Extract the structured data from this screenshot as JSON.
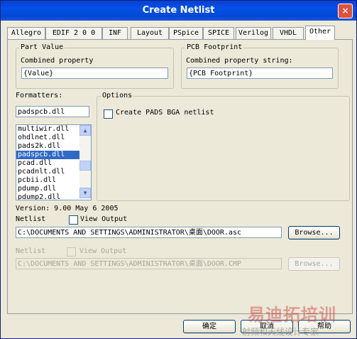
{
  "window": {
    "title": "Create Netlist",
    "close_glyph": "×"
  },
  "tabs": [
    "Allegro",
    "EDIF 2 0 0",
    "INF",
    "Layout",
    "PSpice",
    "SPICE",
    "Verilog",
    "VHDL",
    "Other"
  ],
  "active_tab": "Other",
  "part_value": {
    "group_label": "Part Value",
    "field_label": "Combined property",
    "field_value": "{Value}"
  },
  "pcb_footprint": {
    "group_label": "PCB Footprint",
    "field_label": "Combined property string:",
    "field_value": "{PCB Footprint}"
  },
  "formatters": {
    "label": "Formatters:",
    "value": "padspcb.dll",
    "items": [
      "multiwir.dll",
      "ohdlnet.dll",
      "pads2k.dll",
      "padspcb.dll",
      "pcad.dll",
      "pcadnlt.dll",
      "pcbii.dll",
      "pdump.dll",
      "pdump2.dll"
    ],
    "selected": "padspcb.dll",
    "scroll_up": "▲",
    "scroll_down": "▼"
  },
  "options": {
    "group_label": "Options",
    "create_pads_bga_label": "Create PADS BGA netlist",
    "create_pads_bga_checked": false
  },
  "version_text": "Version: 9.00  May  6 2005",
  "netlist": {
    "label": "Netlist",
    "view_output_label": "View Output",
    "path": "C:\\DOCUMENTS AND SETTINGS\\ADMINISTRATOR\\桌面\\DOOR.asc",
    "browse_label": "Browse..."
  },
  "netlist2": {
    "label": "Netlist",
    "view_output_label": "View Output",
    "path": "C:\\DOCUMENTS AND SETTINGS\\ADMINISTRATOR\\桌面\\DOOR.CMP",
    "browse_label": "Browse..."
  },
  "footer": {
    "ok_label": "确定",
    "cancel_label": "取消",
    "help_label": "帮助"
  },
  "watermark": {
    "line1": "易迪拓培训",
    "line2": "射频和天线设计专家"
  }
}
